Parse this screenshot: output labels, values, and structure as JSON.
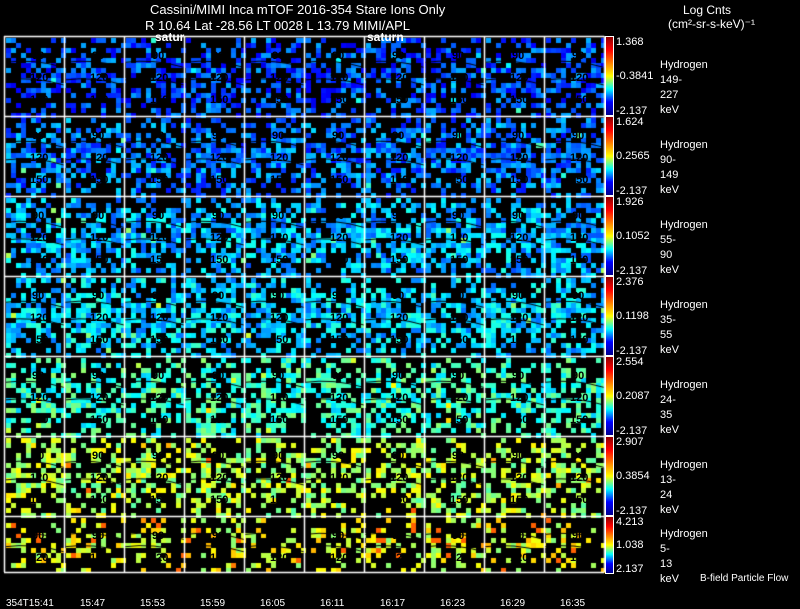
{
  "header": {
    "title": "Cassini/MIMI Inca mTOF  2016-354   Stare   Ions Only",
    "subtitle": "R         10.64 Lat -28.56 LT 0028 L          13.79  MIMI/APL",
    "units_line1": "Log Cnts",
    "units_line2": "(cm²-sr-s-keV)⁻¹",
    "planet_labels": [
      "satur",
      "saturn"
    ]
  },
  "footer": {
    "note": "B-field Particle Flow"
  },
  "chart_data": {
    "type": "heatmap",
    "columns_time": [
      "354T15:41",
      "15:47",
      "15:53",
      "15:59",
      "16:05",
      "16:11",
      "16:17",
      "16:23",
      "16:29",
      "16:35"
    ],
    "overlay_contour_labels": [
      "90",
      "120",
      "150"
    ],
    "colormap": "jet",
    "panels": [
      {
        "species": "Hydrogen",
        "energy": "149-227 keV",
        "max": "1.368",
        "mid": "-0.3841",
        "min": "-2.137"
      },
      {
        "species": "Hydrogen",
        "energy": "90-149 keV",
        "max": "1.624",
        "mid": "0.2565",
        "min": "-2.137"
      },
      {
        "species": "Hydrogen",
        "energy": "55-90 keV",
        "max": "1.926",
        "mid": "0.1052",
        "min": "-2.137"
      },
      {
        "species": "Hydrogen",
        "energy": "35-55 keV",
        "max": "2.376",
        "mid": "0.1198",
        "min": "-2.137"
      },
      {
        "species": "Hydrogen",
        "energy": "24-35 keV",
        "max": "2.554",
        "mid": "0.2087",
        "min": "-2.137"
      },
      {
        "species": "Hydrogen",
        "energy": "13-24 keV",
        "max": "2.907",
        "mid": "0.3854",
        "min": "-2.137"
      },
      {
        "species": "Hydrogen",
        "energy": "5-13 keV",
        "max": "4.213",
        "mid": "1.038",
        "min": "2.137"
      }
    ]
  }
}
